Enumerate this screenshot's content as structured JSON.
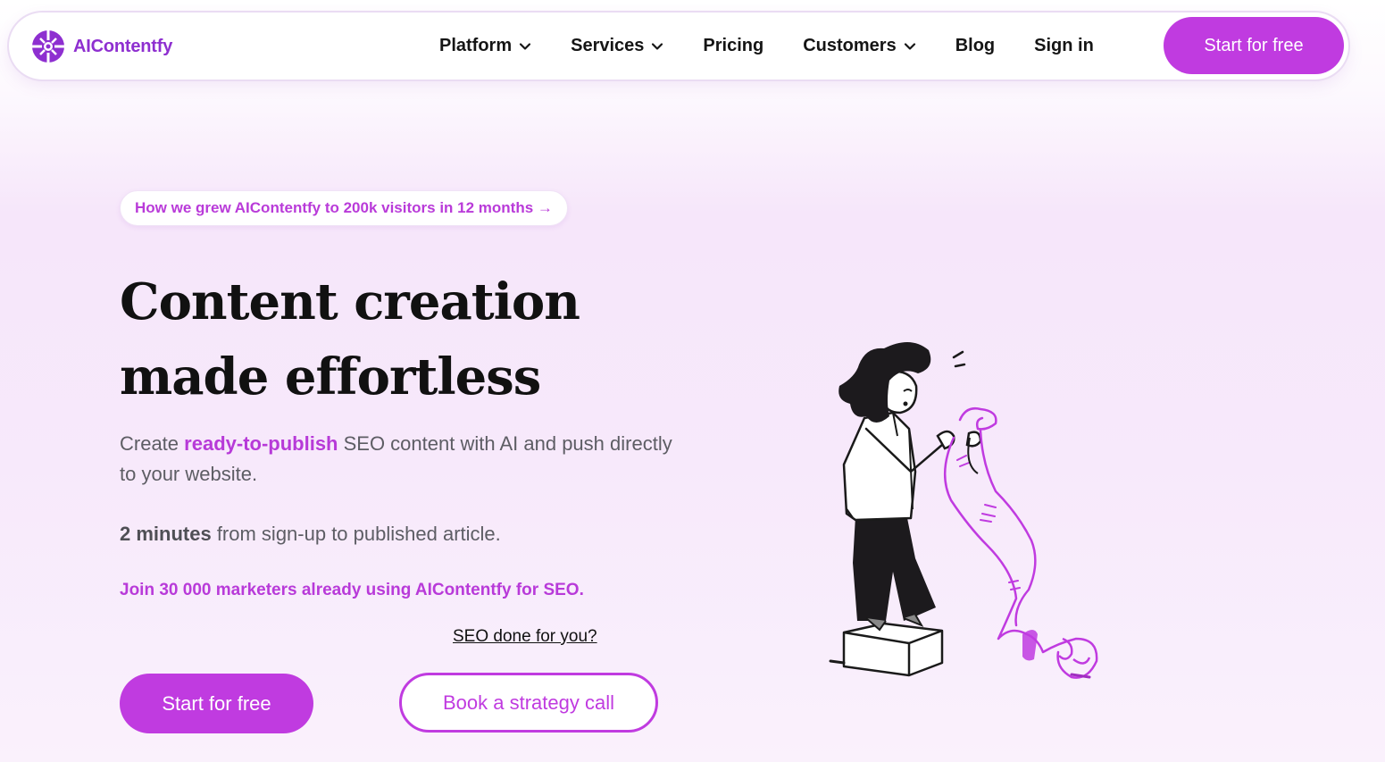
{
  "nav": {
    "brand": "AIContentfy",
    "logo_icon": "aicontentfy-logo-icon",
    "items": [
      {
        "label": "Platform",
        "has_dropdown": true
      },
      {
        "label": "Services",
        "has_dropdown": true
      },
      {
        "label": "Pricing",
        "has_dropdown": false
      },
      {
        "label": "Customers",
        "has_dropdown": true
      },
      {
        "label": "Blog",
        "has_dropdown": false
      },
      {
        "label": "Sign in",
        "has_dropdown": false
      }
    ],
    "cta": "Start for free"
  },
  "hero": {
    "announcement": "How we grew AIContentfy to 200k visitors in 12 months →",
    "title": "Content creation made effortless",
    "desc_prefix": "Create ",
    "desc_highlight": "ready-to-publish",
    "desc_suffix": " SEO content with AI and push directly to your website.",
    "minutes_bold": "2 minutes",
    "minutes_rest": " from sign-up to published article.",
    "join": "Join 30 000 marketers already using AIContentfy for SEO.",
    "seo_link": "SEO done for you?",
    "primary_cta": "Start for free",
    "secondary_cta": "Book a strategy call"
  },
  "colors": {
    "brand": "#c03be0",
    "brand_text": "#8e2fd0",
    "accent_text": "#b83ad9",
    "body_text": "#5d5d64",
    "heading": "#111111"
  }
}
